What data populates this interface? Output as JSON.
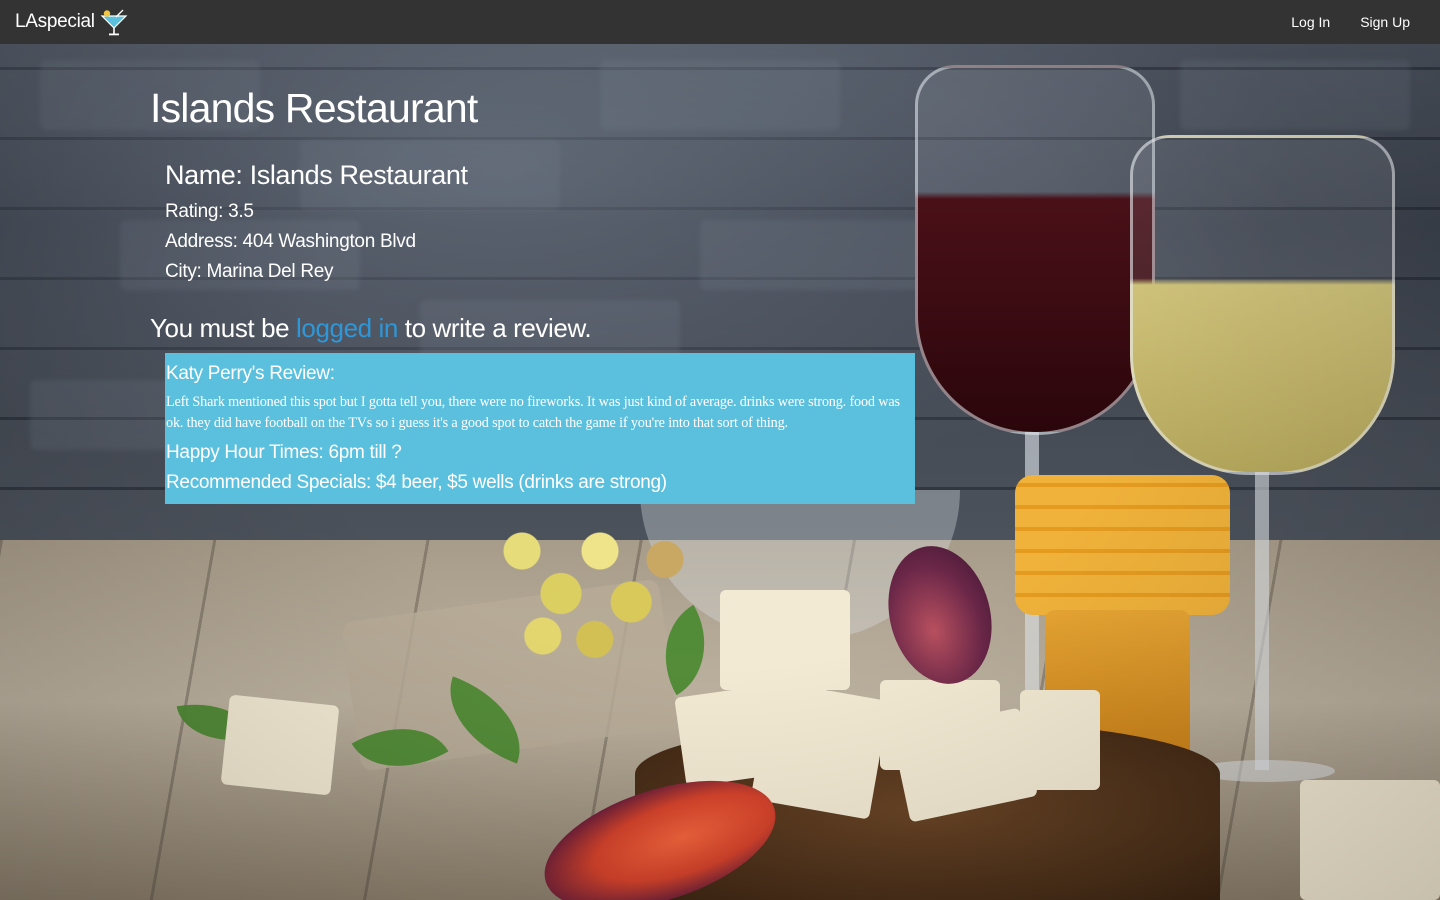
{
  "navbar": {
    "brand": "LAspecial",
    "brand_icon": "cocktail-icon",
    "login_label": "Log In",
    "signup_label": "Sign Up"
  },
  "page": {
    "title": "Islands Restaurant"
  },
  "restaurant": {
    "name_line": "Name: Islands Restaurant",
    "rating_line": "Rating: 3.5",
    "address_line": "Address: 404 Washington Blvd",
    "city_line": "City: Marina Del Rey"
  },
  "review_prompt": {
    "prefix": "You must be ",
    "link_text": "logged in",
    "suffix": " to write a review."
  },
  "reviews": [
    {
      "heading": "Katy Perry's Review:",
      "body": "Left Shark mentioned this spot but I gotta tell you, there were no fireworks. It was just kind of average. drinks were strong. food was ok. they did have football on the TVs so i guess it's a good spot to catch the game if you're into that sort of thing.",
      "happy_hour_line": "Happy Hour Times: 6pm till ?",
      "specials_line": "Recommended Specials: $4 beer, $5 wells (drinks are strong)"
    }
  ],
  "colors": {
    "navbar_bg": "#333333",
    "link": "#2f96d7",
    "review_card_bg": "#5bc0de",
    "text": "#ffffff"
  }
}
